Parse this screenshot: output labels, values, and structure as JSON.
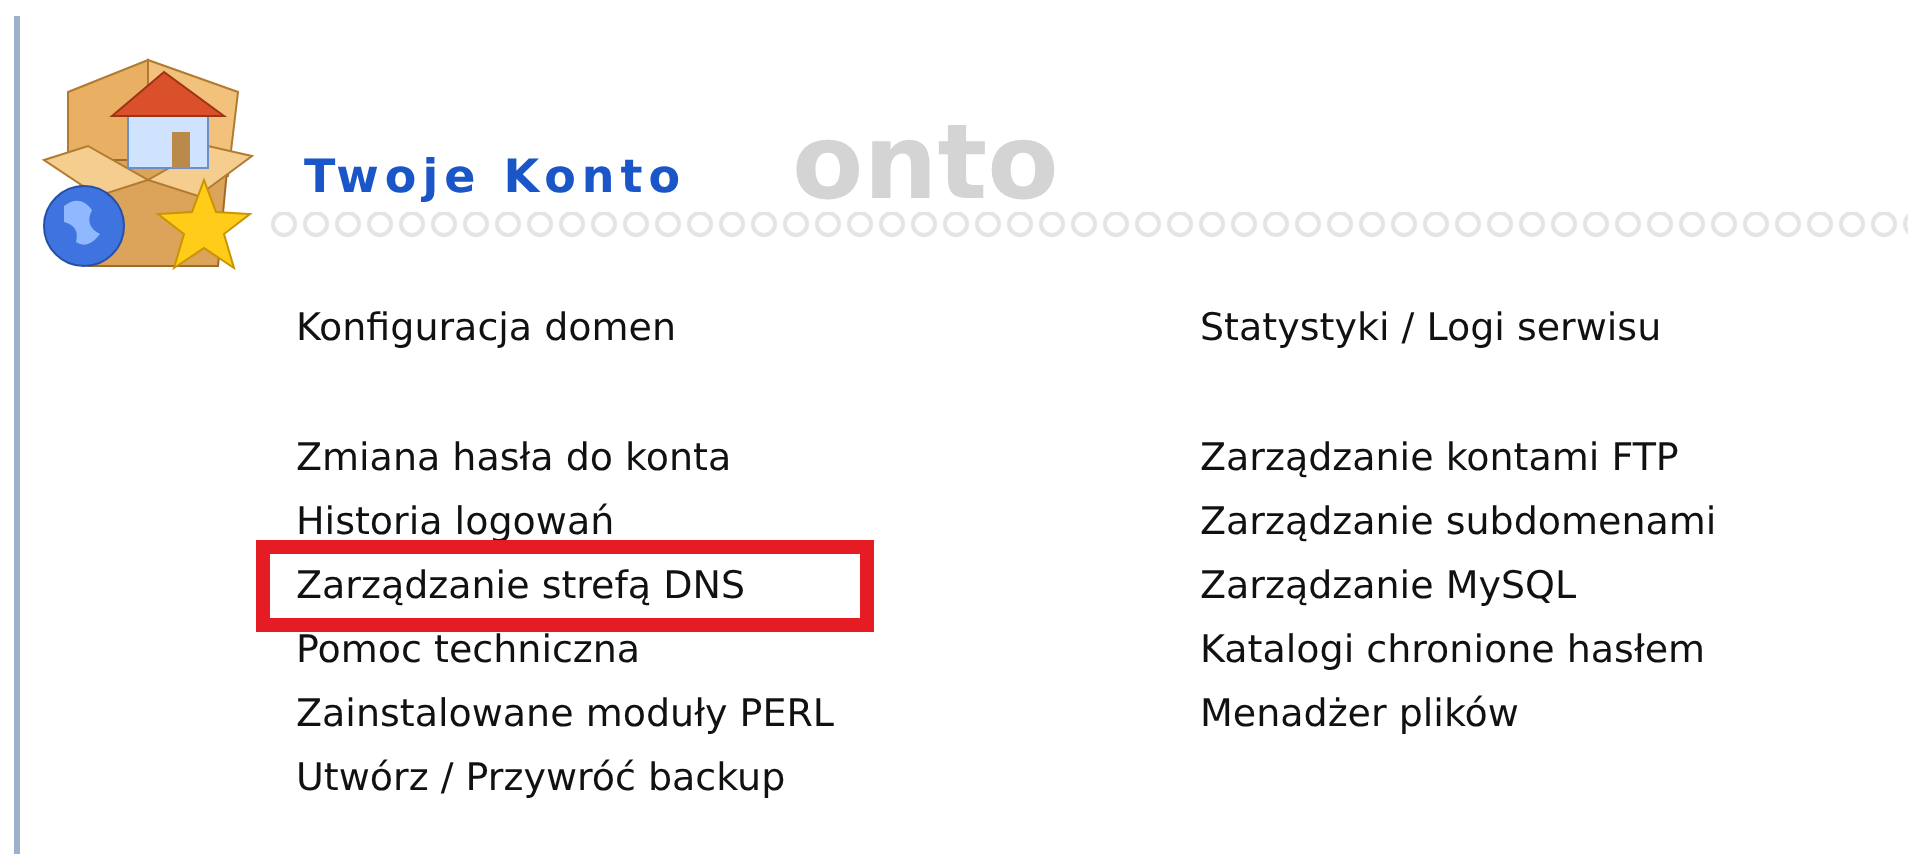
{
  "header": {
    "title": "Twoje Konto",
    "title_shadow": "onto"
  },
  "columns": [
    {
      "groups": [
        [
          {
            "label": "Konfiguracja domen",
            "highlighted": false
          }
        ],
        [
          {
            "label": "Zmiana hasła do konta",
            "highlighted": false
          },
          {
            "label": "Historia logowań",
            "highlighted": false
          },
          {
            "label": "Zarządzanie strefą DNS",
            "highlighted": true
          },
          {
            "label": "Pomoc techniczna",
            "highlighted": false
          },
          {
            "label": "Zainstalowane moduły PERL",
            "highlighted": false
          },
          {
            "label": "Utwórz / Przywróć backup",
            "highlighted": false
          }
        ]
      ]
    },
    {
      "groups": [
        [
          {
            "label": "Statystyki / Logi serwisu",
            "highlighted": false
          }
        ],
        [
          {
            "label": "Zarządzanie kontami FTP",
            "highlighted": false
          },
          {
            "label": "Zarządzanie subdomenami",
            "highlighted": false
          },
          {
            "label": "Zarządzanie MySQL",
            "highlighted": false
          },
          {
            "label": "Katalogi chronione hasłem",
            "highlighted": false
          },
          {
            "label": "Menadżer plików",
            "highlighted": false
          }
        ]
      ]
    }
  ]
}
